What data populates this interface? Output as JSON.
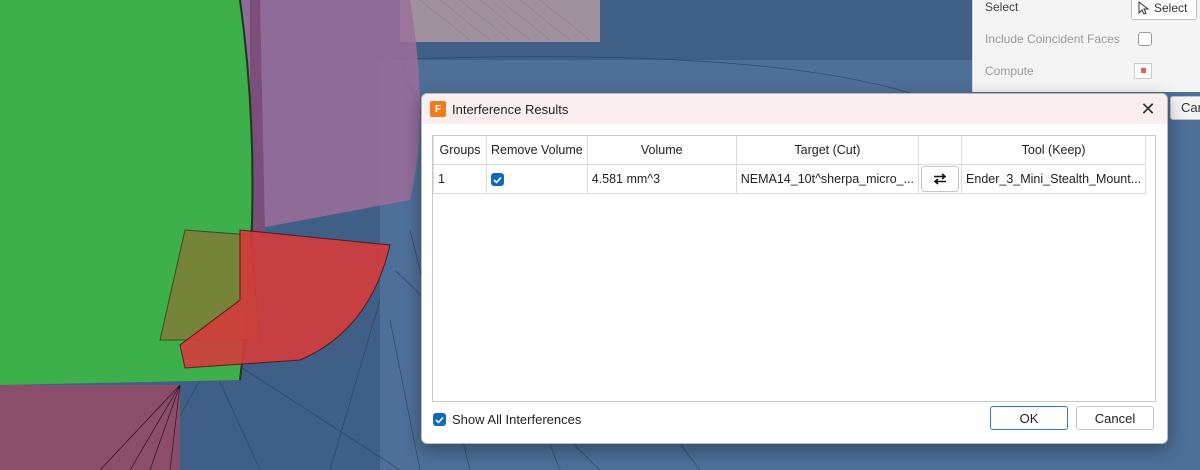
{
  "background_panel": {
    "select_label": "Select",
    "select_button": "Select",
    "include_label": "Include Coincident Faces",
    "compute_label": "Compute",
    "cancel_peek": "Can"
  },
  "dialog": {
    "app_icon_letter": "F",
    "title": "Interference Results",
    "columns": [
      "Groups",
      "Remove Volume",
      "Volume",
      "Target (Cut)",
      "",
      "Tool (Keep)"
    ],
    "rows": [
      {
        "group": "1",
        "remove_volume": true,
        "volume": "4.581 mm^3",
        "target": "NEMA14_10t^sherpa_micro_...",
        "tool": "Ender_3_Mini_Stealth_Mount..."
      }
    ],
    "show_all_label": "Show All Interferences",
    "show_all_checked": true,
    "ok_label": "OK",
    "cancel_label": "Cancel"
  },
  "colors": {
    "accent": "#1067c2",
    "titlebar": "#fbeeee",
    "viewport_bg": "#3f5f86"
  }
}
